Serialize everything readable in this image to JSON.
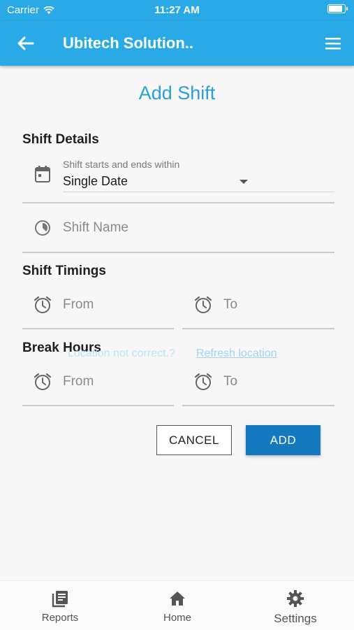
{
  "status_bar": {
    "carrier": "Carrier",
    "time": "11:27 AM",
    "battery_level": 0.95
  },
  "app_bar": {
    "title": "Ubitech Solution.."
  },
  "page": {
    "heading": "Add Shift"
  },
  "shift_details": {
    "section_label": "Shift Details",
    "dropdown_label": "Shift starts and ends within",
    "dropdown_value": "Single Date",
    "shift_name_placeholder": "Shift Name"
  },
  "shift_timings": {
    "section_label": "Shift Timings",
    "from_placeholder": "From",
    "to_placeholder": "To"
  },
  "break_hours": {
    "section_label": "Break Hours",
    "from_placeholder": "From",
    "to_placeholder": "To"
  },
  "overlay": {
    "message": "Location not correct.?",
    "link": "Refresh location"
  },
  "actions": {
    "cancel_label": "CANCEL",
    "add_label": "ADD"
  },
  "bottom_nav": {
    "items": [
      {
        "label": "Reports",
        "icon": "reports-icon"
      },
      {
        "label": "Home",
        "icon": "home-icon"
      },
      {
        "label": "Settings",
        "icon": "gear-icon"
      }
    ]
  },
  "colors": {
    "primary": "#29a9e6",
    "heading": "#2a9fd6",
    "add_button": "#1479bf"
  }
}
